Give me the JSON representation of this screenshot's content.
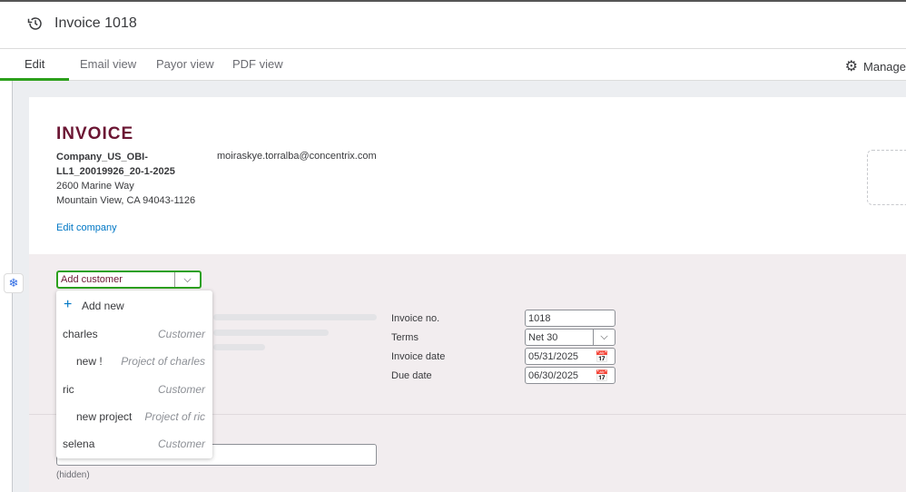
{
  "header": {
    "title": "Invoice 1018"
  },
  "tabs": [
    {
      "label": "Edit"
    },
    {
      "label": "Email view"
    },
    {
      "label": "Payor view"
    },
    {
      "label": "PDF view"
    }
  ],
  "manage_label": "Manage",
  "invoice": {
    "heading": "INVOICE",
    "company_line1": "Company_US_OBI-",
    "company_line2": "LL1_20019926_20-1-2025",
    "address1": "2600 Marine Way",
    "address2": "Mountain View, CA 94043-1126",
    "email": "moiraskye.torralba@concentrix.com",
    "edit_company": "Edit company"
  },
  "customer": {
    "placeholder": "Add customer"
  },
  "menu": {
    "add_new": "Add new",
    "items": [
      {
        "name": "charles",
        "type": "Customer"
      },
      {
        "name": "new !",
        "type": "Project of charles"
      },
      {
        "name": "ric",
        "type": "Customer"
      },
      {
        "name": "new project",
        "type": "Project of ric"
      },
      {
        "name": "selena",
        "type": "Customer"
      }
    ]
  },
  "fields": {
    "invoice_no_label": "Invoice no.",
    "invoice_no": "1018",
    "terms_label": "Terms",
    "terms": "Net 30",
    "invoice_date_label": "Invoice date",
    "invoice_date": "05/31/2025",
    "due_date_label": "Due date",
    "due_date": "06/30/2025"
  },
  "hidden_label": "(hidden)",
  "colors": {
    "accent": "#2ca01c",
    "heading": "#6b1633",
    "link": "#0077c5"
  }
}
